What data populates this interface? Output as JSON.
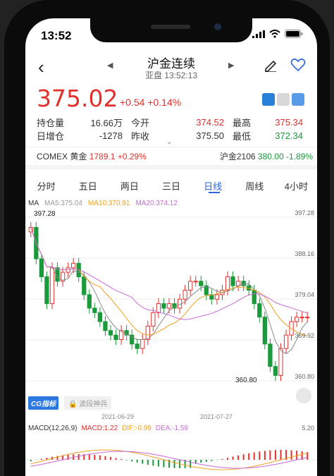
{
  "status": {
    "time": "13:52"
  },
  "header": {
    "title": "沪金连续",
    "subtitle": "亚盘 13:52:13"
  },
  "quote": {
    "price": "375.02",
    "change": "+0.54",
    "change_pct": "+0.14%"
  },
  "stats": {
    "row1": {
      "l1": "持仓量",
      "v1": "16.66万",
      "l2": "今开",
      "v2": "374.52",
      "l3": "最高",
      "v3": "375.34"
    },
    "row2": {
      "l1": "日增仓",
      "v1": "-1278",
      "l2": "昨收",
      "v2": "375.50",
      "l3": "最低",
      "v3": "372.34"
    }
  },
  "related": {
    "left_name": "COMEX 黄金",
    "left_val": "1789.1",
    "left_pct": "+0.29%",
    "right_name": "沪金2106",
    "right_val": "380.00",
    "right_pct": "-1.89%"
  },
  "tabs": [
    "分时",
    "五日",
    "两日",
    "三日",
    "日线",
    "周线",
    "4小时"
  ],
  "active_tab": "日线",
  "ma": {
    "label": "MA",
    "ma5": "MA5:375.04",
    "ma10": "MA10:370.91",
    "ma20": "MA20:374.12"
  },
  "colors": {
    "up": "#e2302d",
    "down": "#1a9a3a",
    "ma5": "#888888",
    "ma10": "#f0a020",
    "ma20": "#c86ad8",
    "accent": "#2a64d8"
  },
  "chart_data": {
    "type": "candlestick",
    "y_ticks": [
      "397.28",
      "388.16",
      "379.04",
      "369.92",
      "360.80"
    ],
    "max_label": "397.28",
    "min_label": "360.80",
    "x_ticks": [
      "2021-06-29",
      "2021-07-27"
    ]
  },
  "chips": {
    "cg": "CG指标",
    "wave": "波段神兵"
  },
  "macd": {
    "label": "MACD(12,26,9)",
    "macd": "MACD:1.22",
    "dif": "DIF:-0.99",
    "dea": "DEA:-1.59",
    "top_tick": "5.20"
  }
}
